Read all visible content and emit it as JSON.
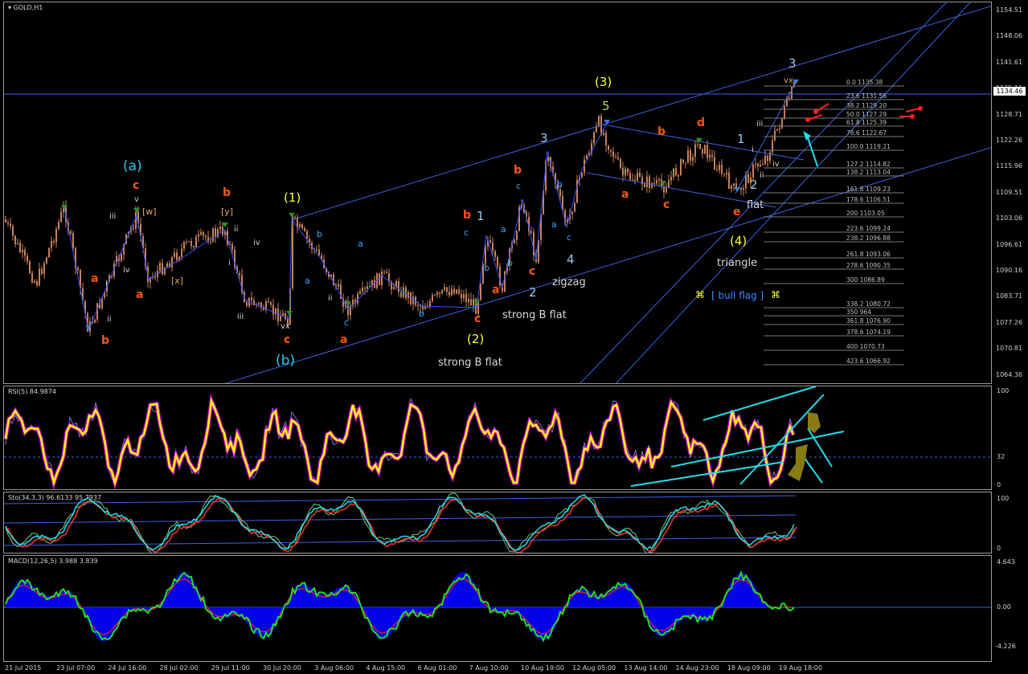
{
  "window": {
    "symbol_title": "GOLD,H1"
  },
  "current_price": "1134.46",
  "price_axis": [
    "1154.51",
    "1148.06",
    "1141.61",
    "1135.16",
    "1128.71",
    "1122.26",
    "1115.96",
    "1109.51",
    "1103.06",
    "1096.61",
    "1090.16",
    "1083.71",
    "1077.26",
    "1070.81",
    "1064.36"
  ],
  "time_axis": [
    "21 Jul 2015",
    "23 Jul 07:00",
    "24 Jul 16:00",
    "28 Jul 02:00",
    "29 Jul 11:00",
    "30 Jul 20:00",
    "3 Aug 06:00",
    "4 Aug 15:00",
    "6 Aug 01:00",
    "7 Aug 10:00",
    "10 Aug 19:00",
    "12 Aug 05:00",
    "13 Aug 14:00",
    "14 Aug 23:00",
    "18 Aug 09:00",
    "19 Aug 18:00"
  ],
  "fibonacci_levels": [
    "0.0 1135.38",
    "23.6 1131.56",
    "38.2 1129.20",
    "50.0 1127.29",
    "61.8 1125.39",
    "78.6 1122.67",
    "100.0 1119.21",
    "127.2 1114.82",
    "138.2 1113.04",
    "161.8 1109.23",
    "178.6 1106.51",
    "200 1103.05",
    "223.6 1099.24",
    "238.2 1096.88",
    "261.8 1093.06",
    "278.6 1090.35",
    "300 1086.89",
    "338.2 1080.72",
    "350 964",
    "361.8 1076.90",
    "378.6 1074.19",
    "400 1070.73",
    "423.6 1066.92"
  ],
  "wave_labels": {
    "a_paren": "(a)",
    "b_paren": "(b)",
    "one_paren": "(1)",
    "two_paren": "(2)",
    "three_paren": "(3)",
    "four_paren": "(4)",
    "c": "c",
    "b": "b",
    "a": "a",
    "d": "d",
    "e": "e",
    "n1": "1",
    "n2": "2",
    "n3": "3",
    "n4": "4",
    "n5": "5",
    "i": "i",
    "ii": "ii",
    "iii": "iii",
    "iv": "iv",
    "v": "v",
    "vx": "vx",
    "w_br": "[w]",
    "x_br": "[x]",
    "y_br": "[y]"
  },
  "annotations": {
    "strong_b_flat_1": "strong B flat",
    "strong_b_flat_2": "strong B flat",
    "zigzag": "zigzag",
    "flat": "flat",
    "triangle": "triangle",
    "bull_flag": "[ bull flag ]",
    "bull_flag_icon": "⌘"
  },
  "indicators": {
    "rsi": {
      "title": "RSI(5) 84.9874",
      "axis": [
        "100",
        "32",
        "0"
      ]
    },
    "sto": {
      "title": "Sto(34,3,3) 96.6133 95.7937",
      "axis": [
        "100",
        "0"
      ]
    },
    "macd": {
      "title": "MACD(12,26,5) 3.988 3.839",
      "axis": [
        "4.643",
        "0.00",
        "-4.226"
      ]
    }
  },
  "colors": {
    "candle": "#c8825a",
    "channel": "#3a64e6",
    "rsi": "#ffff00",
    "rsi_glow": "#ff00ff",
    "annotation_arrow": "#22ddee",
    "fib": "#7a7a7a",
    "macd_hist": "#0000ff",
    "macd_line": "#22dd22"
  },
  "chart_data": {
    "type": "candlestick",
    "title": "GOLD,H1",
    "ylim": [
      1064.36,
      1154.51
    ],
    "series": [
      {
        "name": "close",
        "x": [
          "21 Jul 2015",
          "23 Jul 07:00",
          "24 Jul 16:00",
          "28 Jul 02:00",
          "29 Jul 11:00",
          "30 Jul 20:00",
          "3 Aug 06:00",
          "4 Aug 15:00",
          "6 Aug 01:00",
          "7 Aug 10:00",
          "10 Aug 19:00",
          "12 Aug 05:00",
          "13 Aug 14:00",
          "14 Aug 23:00",
          "18 Aug 09:00",
          "19 Aug 18:00"
        ],
        "values": [
          1103,
          1078,
          1104,
          1092,
          1097,
          1081,
          1092,
          1086,
          1086,
          1092,
          1097,
          1126,
          1113,
          1117,
          1110,
          1135
        ]
      }
    ]
  }
}
